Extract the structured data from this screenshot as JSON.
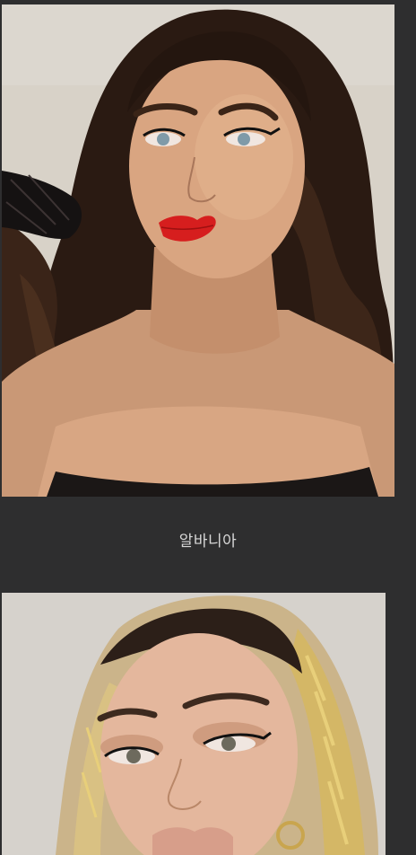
{
  "gallery": {
    "items": [
      {
        "caption": ""
      },
      {
        "caption": "알바니아"
      }
    ]
  },
  "colors": {
    "background": "#2e2e2f",
    "caption_text": "#d8d8d8",
    "lip_red": "#d61e1e"
  }
}
